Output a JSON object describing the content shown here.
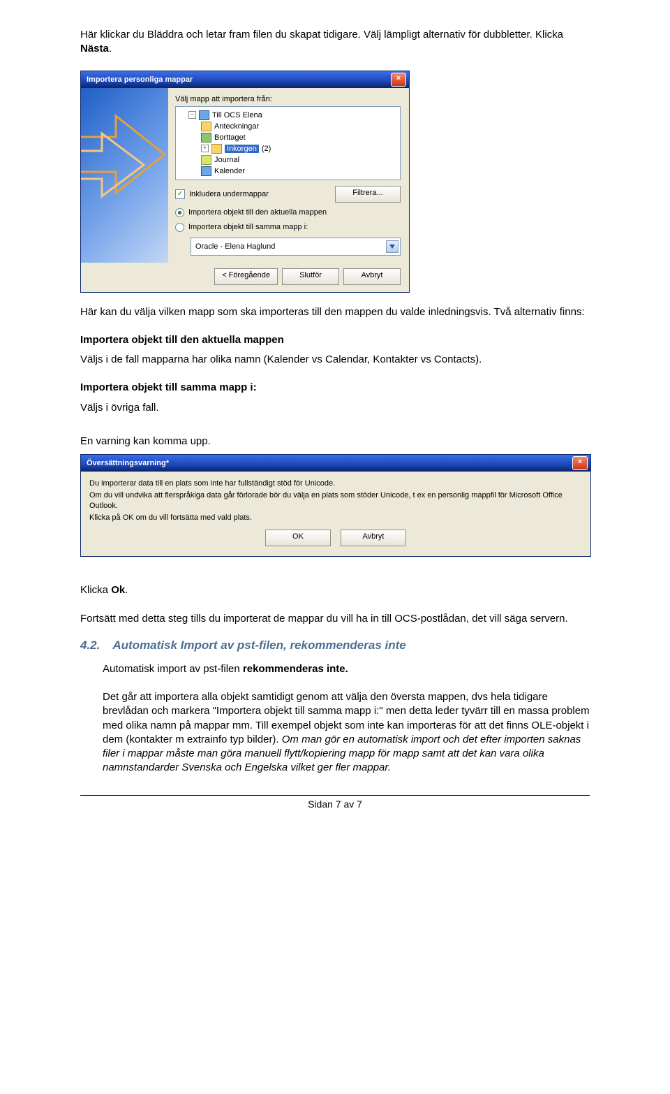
{
  "intro": {
    "line1_a": "Här klickar du Bläddra och letar fram filen du skapat tidigare. Välj lämpligt alternativ för dubbletter. Klicka ",
    "line1_b": "Nästa",
    "line1_c": "."
  },
  "dlg1": {
    "title": "Importera personliga mappar",
    "label_choose": "Välj mapp att importera från:",
    "tree": {
      "root": "Till OCS Elena",
      "items": [
        {
          "name": "Anteckningar"
        },
        {
          "name": "Borttaget"
        },
        {
          "name": "Inkorgen",
          "suffix": "(2)",
          "selected": true,
          "expandable": true
        },
        {
          "name": "Journal"
        },
        {
          "name": "Kalender"
        }
      ]
    },
    "chk_label": "Inkludera undermappar",
    "btn_filter": "Filtrera...",
    "radio1": "Importera objekt till den aktuella mappen",
    "radio2": "Importera objekt till samma mapp i:",
    "combo": "Oracle - Elena Haglund",
    "btn_prev": "< Föregående",
    "btn_finish": "Slutför",
    "btn_cancel": "Avbryt"
  },
  "mid": {
    "p1": "Här kan du välja vilken mapp som ska importeras till den mappen du valde inledningsvis. Två alternativ finns:",
    "b1": "Importera objekt till den aktuella mappen",
    "p2": "Väljs i de fall mapparna har olika namn (Kalender vs Calendar, Kontakter vs Contacts).",
    "b2": "Importera objekt till samma mapp i:",
    "p3": "Väljs i övriga fall.",
    "p4": "En varning kan komma upp."
  },
  "dlg2": {
    "title": "Översättningsvarning*",
    "l1": "Du importerar data till en plats som inte har fullständigt stöd för Unicode.",
    "l2": "Om du vill undvika att flerspråkiga data går förlorade bör du välja en plats som stöder Unicode, t ex en personlig mappfil för Microsoft Office Outlook.",
    "l3": "Klicka på OK om du vill fortsätta med vald plats.",
    "btn_ok": "OK",
    "btn_cancel": "Avbryt"
  },
  "after": {
    "klicka_a": "Klicka ",
    "klicka_b": "Ok",
    "klicka_c": ".",
    "p_fortsatt": "Fortsätt med detta steg tills du importerat de mappar du vill ha in till OCS-postlådan, det vill säga servern."
  },
  "h42": {
    "num": "4.2.",
    "text": "Automatisk Import av pst-filen, rekommenderas inte"
  },
  "sec42": {
    "p1_a": "Automatisk import av pst-filen ",
    "p1_b": "rekommenderas inte.",
    "p2_a": "Det går att importera alla objekt samtidigt genom att välja den översta mappen, dvs hela tidigare brevlådan och markera \"Importera objekt till samma mapp i:\" men detta leder tyvärr till en massa problem med olika namn på mappar mm. Till exempel objekt som inte kan importeras för att det finns OLE-objekt i dem (kontakter m extrainfo typ bilder). ",
    "p2_b": "Om man gör en automatisk import och det efter importen saknas filer i mappar måste man göra manuell flytt/kopiering mapp för mapp samt att det kan vara olika namnstandarder Svenska och Engelska vilket ger fler mappar."
  },
  "footer": "Sidan 7 av 7"
}
